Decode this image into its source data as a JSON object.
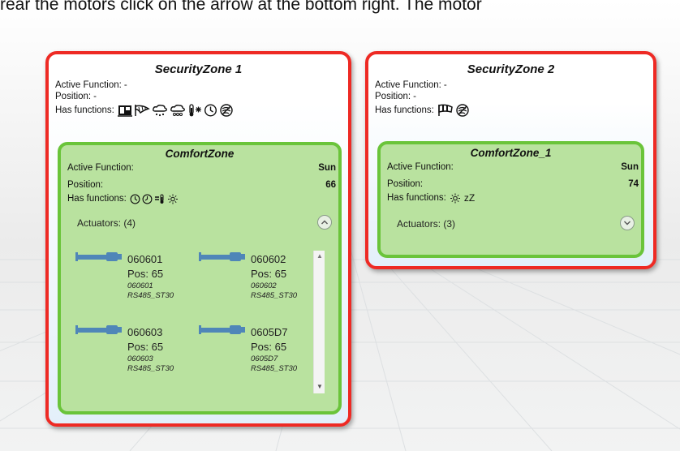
{
  "instruction_text": "rear the motors click on the arrow at the bottom right. The motor",
  "labels": {
    "active_function": "Active Function:",
    "position": "Position:",
    "has_functions": "Has functions:"
  },
  "security_zones": [
    {
      "title": "SecurityZone 1",
      "active_function_value": "-",
      "position_value": "-",
      "function_icons": [
        "ventilation-icon",
        "awning-icon",
        "rain-icon",
        "hail-icon",
        "frost-icon",
        "clock-icon",
        "no-wind-icon"
      ],
      "comfort_zone": {
        "title": "ComfortZone",
        "active_function_value": "Sun",
        "position_value": "66",
        "function_icons": [
          "clock-icon",
          "clock-icon",
          "temperature-icon",
          "sun-icon"
        ],
        "actuators_label": "Actuators: (4)",
        "expanded": true,
        "actuators": [
          {
            "id": "060601",
            "pos": "Pos: 65",
            "sub1": "060601",
            "sub2": "RS485_ST30"
          },
          {
            "id": "060602",
            "pos": "Pos: 65",
            "sub1": "060602",
            "sub2": "RS485_ST30"
          },
          {
            "id": "060603",
            "pos": "Pos: 65",
            "sub1": "060603",
            "sub2": "RS485_ST30"
          },
          {
            "id": "0605D7",
            "pos": "Pos: 65",
            "sub1": "0605D7",
            "sub2": "RS485_ST30"
          }
        ]
      }
    },
    {
      "title": "SecurityZone 2",
      "active_function_value": "-",
      "position_value": "-",
      "function_icons": [
        "wind-warning-icon",
        "no-wind-icon"
      ],
      "comfort_zone": {
        "title": "ComfortZone_1",
        "active_function_value": "Sun",
        "position_value": "74",
        "function_icons": [
          "sun-icon"
        ],
        "sleep_text": "zZ",
        "actuators_label": "Actuators: (3)",
        "expanded": false
      }
    }
  ],
  "colors": {
    "security_border": "#ee2a24",
    "comfort_border": "#6ac43a",
    "comfort_fill": "#b9e29f",
    "actuator_blue": "#4f86b8"
  }
}
